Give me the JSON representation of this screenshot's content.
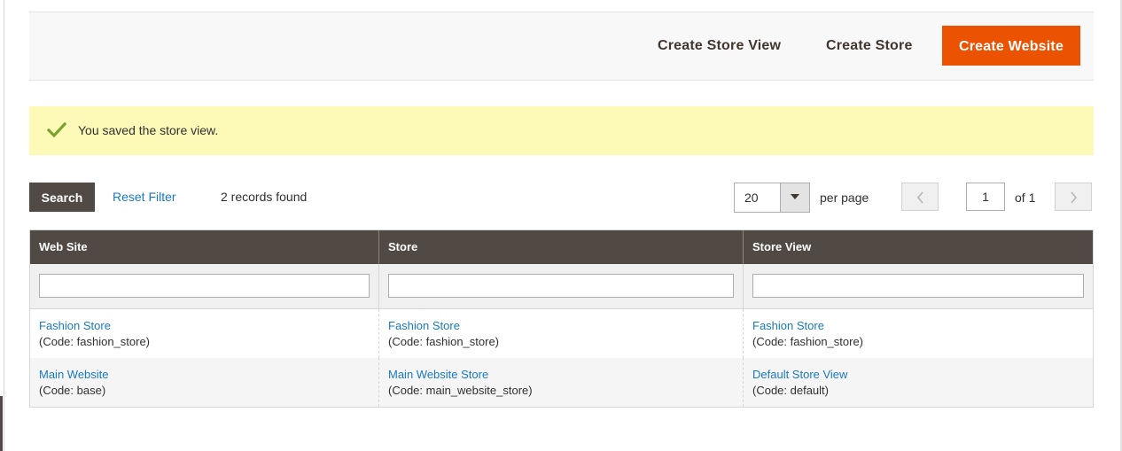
{
  "page_actions": {
    "create_store_view": "Create Store View",
    "create_store": "Create Store",
    "create_website": "Create Website"
  },
  "message": {
    "text": "You saved the store view.",
    "icon": "checkmark-icon",
    "color": "#79a22e"
  },
  "toolbar": {
    "search_label": "Search",
    "reset_filter_label": "Reset Filter",
    "records_found": "2 records found",
    "per_page_value": "20",
    "per_page_label": "per page",
    "current_page": "1",
    "total_pages_label": "of 1"
  },
  "grid": {
    "columns": [
      "Web Site",
      "Store",
      "Store View"
    ],
    "rows": [
      {
        "website": {
          "name": "Fashion Store",
          "code": "(Code: fashion_store)"
        },
        "store": {
          "name": "Fashion Store",
          "code": "(Code: fashion_store)"
        },
        "store_view": {
          "name": "Fashion Store",
          "code": "(Code: fashion_store)"
        }
      },
      {
        "website": {
          "name": "Main Website",
          "code": "(Code: base)"
        },
        "store": {
          "name": "Main Website Store",
          "code": "(Code: main_website_store)"
        },
        "store_view": {
          "name": "Default Store View",
          "code": "(Code: default)"
        }
      }
    ]
  },
  "colors": {
    "accent": "#eb5202",
    "header_bg": "#514943",
    "link": "#1979c3",
    "message_bg": "#fdfab8"
  }
}
